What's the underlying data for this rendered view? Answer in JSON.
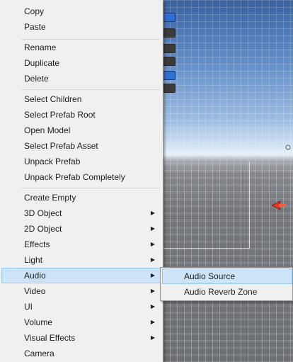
{
  "context_menu": {
    "groups": [
      {
        "items": [
          {
            "label": "Copy"
          },
          {
            "label": "Paste"
          }
        ]
      },
      {
        "items": [
          {
            "label": "Rename"
          },
          {
            "label": "Duplicate"
          },
          {
            "label": "Delete"
          }
        ]
      },
      {
        "items": [
          {
            "label": "Select Children"
          },
          {
            "label": "Select Prefab Root"
          },
          {
            "label": "Open Model"
          },
          {
            "label": "Select Prefab Asset"
          },
          {
            "label": "Unpack Prefab"
          },
          {
            "label": "Unpack Prefab Completely"
          }
        ]
      },
      {
        "items": [
          {
            "label": "Create Empty",
            "has_submenu": false
          },
          {
            "label": "3D Object",
            "has_submenu": true
          },
          {
            "label": "2D Object",
            "has_submenu": true
          },
          {
            "label": "Effects",
            "has_submenu": true
          },
          {
            "label": "Light",
            "has_submenu": true
          },
          {
            "label": "Audio",
            "has_submenu": true,
            "highlighted": true
          },
          {
            "label": "Video",
            "has_submenu": true
          },
          {
            "label": "UI",
            "has_submenu": true
          },
          {
            "label": "Volume",
            "has_submenu": true
          },
          {
            "label": "Visual Effects",
            "has_submenu": true
          },
          {
            "label": "Camera",
            "has_submenu": false
          }
        ]
      }
    ],
    "submenu_arrow": "▶"
  },
  "audio_submenu": {
    "items": [
      {
        "label": "Audio Source",
        "highlighted": true
      },
      {
        "label": "Audio Reverb Zone"
      }
    ]
  },
  "colors": {
    "menu_background": "#f0f0f0",
    "highlight_fill": "#cce4f7",
    "highlight_border": "#99c9ef",
    "gizmo_red": "#e8361f"
  }
}
